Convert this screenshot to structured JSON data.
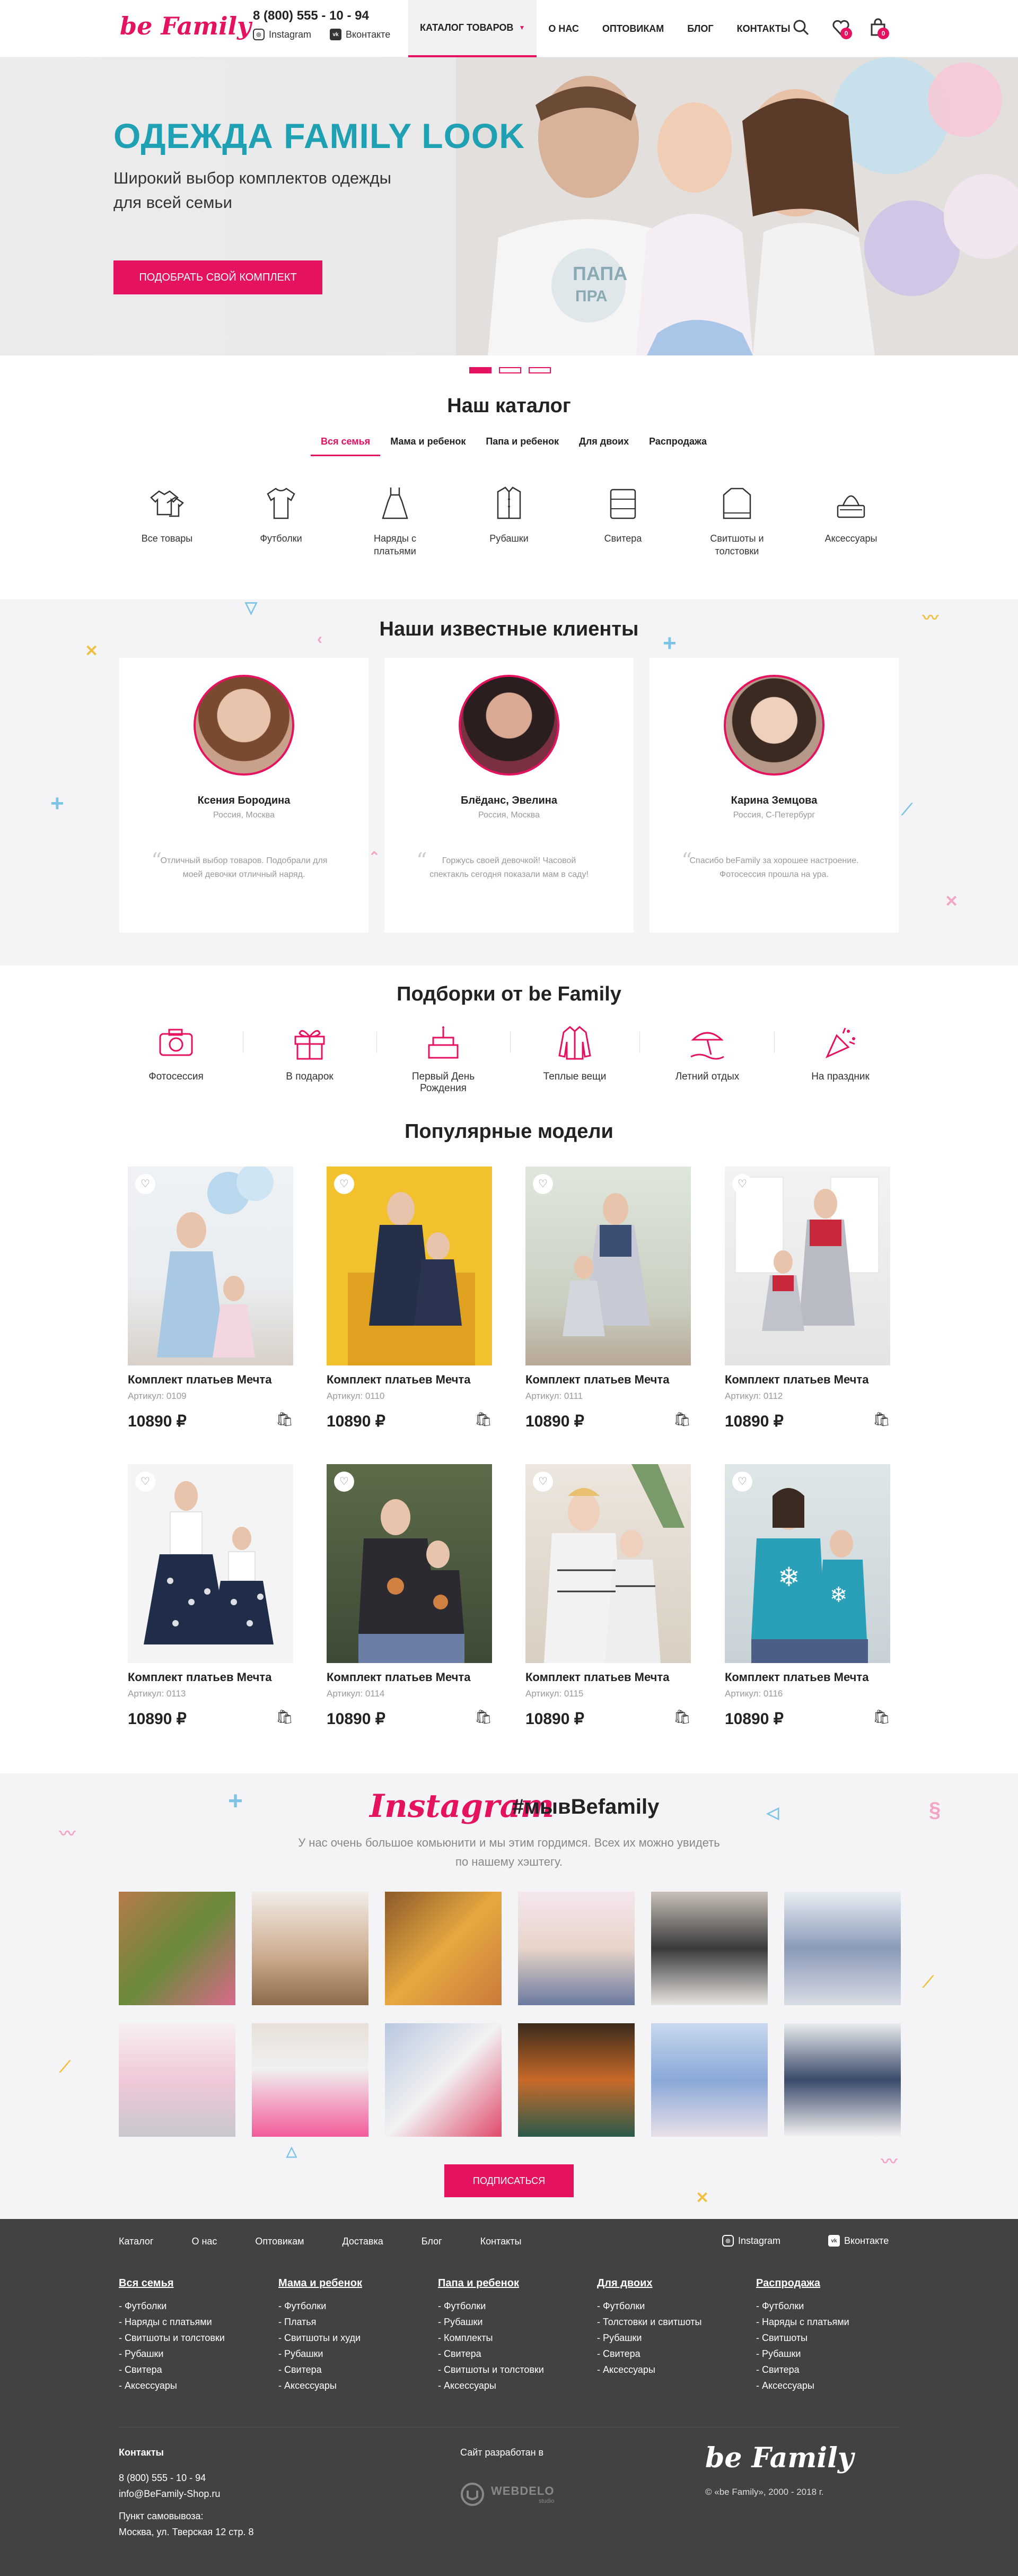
{
  "header": {
    "logo": "be Family",
    "phone": "8 (800) 555 - 10 - 94",
    "instagram": "Instagram",
    "vk": "Вконтакте",
    "nav": [
      "КАТАЛОГ ТОВАРОВ",
      "О НАС",
      "ОПТОВИКАМ",
      "БЛОГ",
      "КОНТАКТЫ"
    ],
    "wishlist_count": "0",
    "cart_count": "0"
  },
  "hero": {
    "title": "ОДЕЖДА FAMILY LOOK",
    "subtitle": "Широкий выбор комплектов одежды для всей семьи",
    "button": "ПОДОБРАТЬ СВОЙ КОМПЛЕКТ",
    "shirt_text_1": "ПАПА",
    "shirt_text_2": "ПРА"
  },
  "catalog": {
    "title": "Наш каталог",
    "tabs": [
      "Вся семья",
      "Мама и ребенок",
      "Папа и ребенок",
      "Для двоих",
      "Распродажа"
    ],
    "categories": [
      {
        "label": "Все товары",
        "icon": "all-items-icon"
      },
      {
        "label": "Футболки",
        "icon": "tshirt-icon"
      },
      {
        "label": "Наряды с платьями",
        "icon": "dress-icon"
      },
      {
        "label": "Рубашки",
        "icon": "shirt-icon"
      },
      {
        "label": "Свитера",
        "icon": "sweater-icon"
      },
      {
        "label": "Свитшоты и толстовки",
        "icon": "sweatshirt-icon"
      },
      {
        "label": "Аксессуары",
        "icon": "accessories-icon"
      }
    ]
  },
  "clients": {
    "title": "Наши известные клиенты",
    "items": [
      {
        "name": "Ксения Бородина",
        "city": "Россия, Москва",
        "quote": "Отличный выбор товаров. Подобрали для моей девочки отличный наряд."
      },
      {
        "name": "Блёданс, Эвелина",
        "city": "Россия, Москва",
        "quote": "Горжусь своей девочкой! Часовой спектакль сегодня показали мам в саду!"
      },
      {
        "name": "Карина Земцова",
        "city": "Россия, С-Петербург",
        "quote": "Спасибо beFamily за хорошее настроение. Фотосессия прошла на ура."
      }
    ]
  },
  "collections": {
    "title": "Подборки от be Family",
    "items": [
      {
        "label": "Фотосессия",
        "icon": "camera-icon"
      },
      {
        "label": "В подарок",
        "icon": "gift-icon"
      },
      {
        "label": "Первый День Рождения",
        "icon": "cake-icon"
      },
      {
        "label": "Теплые вещи",
        "icon": "jacket-icon"
      },
      {
        "label": "Летний отдых",
        "icon": "beach-icon"
      },
      {
        "label": "На праздник",
        "icon": "party-icon"
      }
    ]
  },
  "popular": {
    "title": "Популярные модели",
    "products": [
      {
        "title": "Комплект платьев Мечта",
        "article": "Артикул: 0109",
        "price": "10890 ₽"
      },
      {
        "title": "Комплект платьев Мечта",
        "article": "Артикул: 0110",
        "price": "10890 ₽"
      },
      {
        "title": "Комплект платьев Мечта",
        "article": "Артикул: 0111",
        "price": "10890 ₽"
      },
      {
        "title": "Комплект платьев Мечта",
        "article": "Артикул: 0112",
        "price": "10890 ₽"
      },
      {
        "title": "Комплект платьев Мечта",
        "article": "Артикул: 0113",
        "price": "10890 ₽"
      },
      {
        "title": "Комплект платьев Мечта",
        "article": "Артикул: 0114",
        "price": "10890 ₽"
      },
      {
        "title": "Комплект платьев Мечта",
        "article": "Артикул: 0115",
        "price": "10890 ₽"
      },
      {
        "title": "Комплект платьев Мечта",
        "article": "Артикул: 0116",
        "price": "10890 ₽"
      }
    ]
  },
  "instagram": {
    "brand": "Instagram",
    "hashtag": "#мывBefamily",
    "text": "У нас очень большое комьюнити и мы этим гордимся. Всех их можно увидеть по нашему хэштегу.",
    "button": "ПОДПИСАТЬСЯ"
  },
  "footer": {
    "nav": [
      "Каталог",
      "О нас",
      "Оптовикам",
      "Доставка",
      "Блог",
      "Контакты"
    ],
    "instagram": "Instagram",
    "vk": "Вконтакте",
    "columns": [
      {
        "title": "Вся семья",
        "items": [
          "Футболки",
          "Наряды с платьями",
          "Свитшоты и толстовки",
          "Рубашки",
          "Свитера",
          "Аксессуары"
        ]
      },
      {
        "title": "Мама и ребенок",
        "items": [
          "Футболки",
          "Платья",
          "Свитшоты и худи",
          "Рубашки",
          "Свитера",
          "Аксессуары"
        ]
      },
      {
        "title": "Папа и ребенок",
        "items": [
          "Футболки",
          "Рубашки",
          "Комплекты",
          "Свитера",
          "Свитшоты и толстовки",
          "Аксессуары"
        ]
      },
      {
        "title": "Для двоих",
        "items": [
          "Футболки",
          "Толстовки и свитшоты",
          "Рубашки",
          "Свитера",
          "Аксессуары"
        ]
      },
      {
        "title": "Распродажа",
        "items": [
          "Футболки",
          "Наряды с платьями",
          "Свитшоты",
          "Рубашки",
          "Свитера",
          "Аксессуары"
        ]
      }
    ],
    "contacts_title": "Контакты",
    "phone": "8 (800) 555 - 10 - 94",
    "email": "info@BeFamily-Shop.ru",
    "pickup_label": "Пункт самовывоза:",
    "pickup_address": "Москва, ул. Тверская 12 стр. 8",
    "dev_label": "Сайт разработан в",
    "dev_name": "WEBDELO",
    "dev_sub": "studio",
    "logo": "be Family",
    "copyright": "© «be Family», 2000 - 2018 г."
  },
  "colors": {
    "accent": "#e5125f",
    "teal": "#1fa0b3",
    "footer_bg": "#424242",
    "section_bg": "#f4f4f7"
  }
}
